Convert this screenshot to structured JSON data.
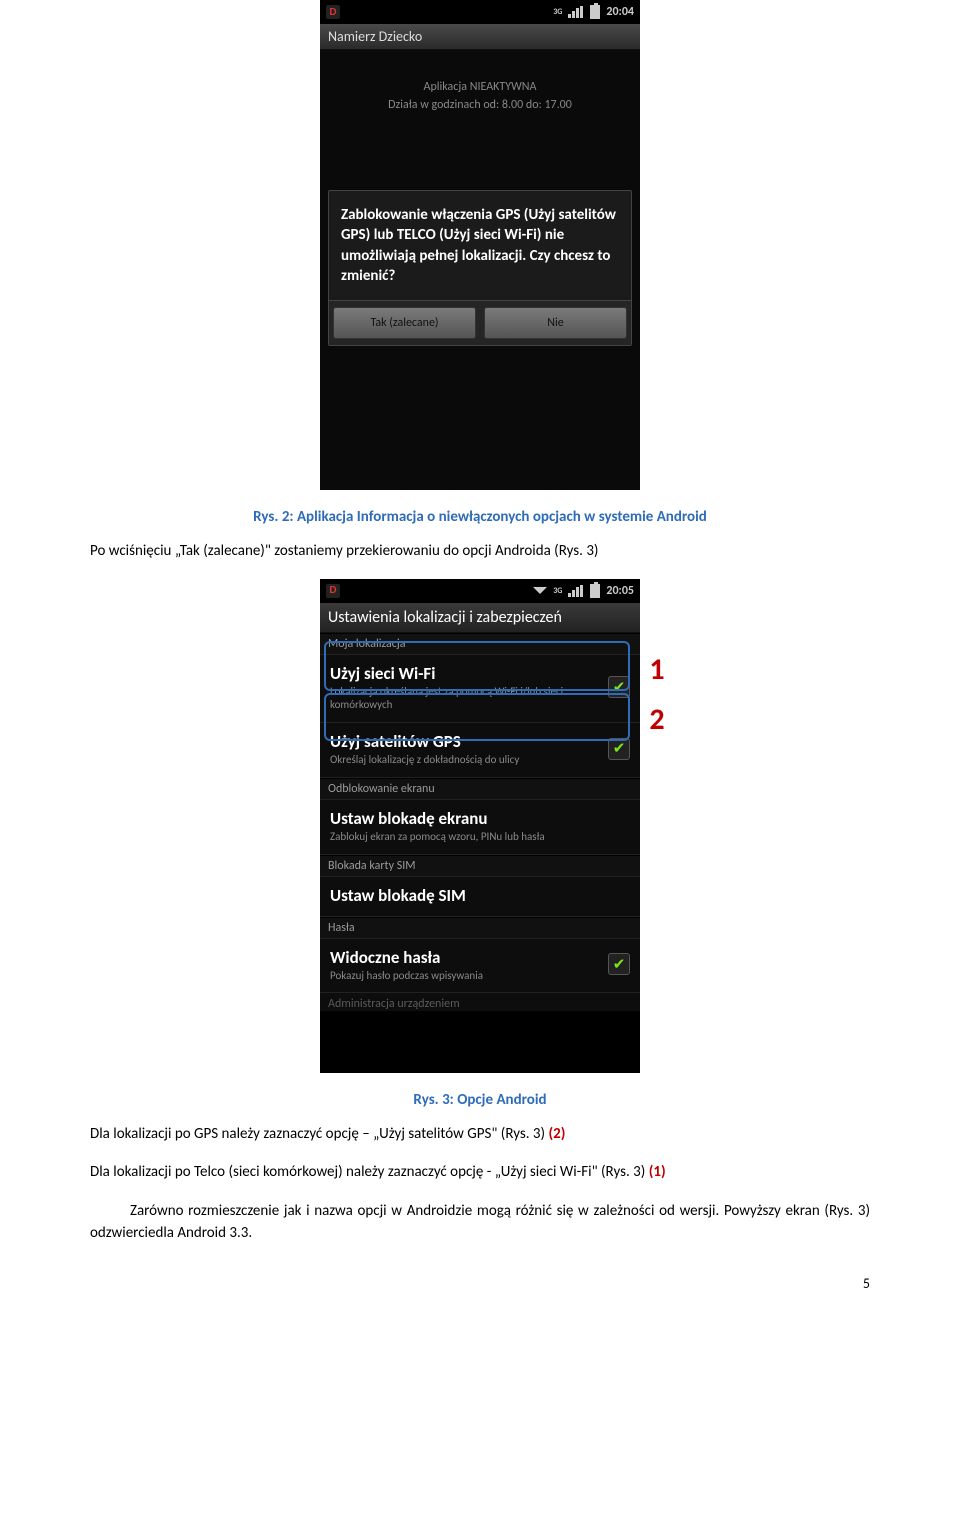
{
  "phone1": {
    "status": {
      "time": "20:04",
      "net": "3G"
    },
    "appTitle": "Namierz Dziecko",
    "inactiveLine1": "Aplikacja NIEAKTYWNA",
    "inactiveLine2": "Działa w godzinach od: 8.00 do: 17.00",
    "dialogText": "Zablokowanie włączenia GPS (Użyj satelitów GPS) lub TELCO (Użyj sieci Wi-Fi) nie umożliwiają pełnej lokalizacji. Czy chcesz to zmienić?",
    "btnYes": "Tak (zalecane)",
    "btnNo": "Nie"
  },
  "caption1": "Rys. 2: Aplikacja Informacja o niewłączonych opcjach w systemie Android",
  "para1": "Po wciśnięciu „Tak (zalecane)\" zostaniemy przekierowaniu do opcji Androida (Rys. 3)",
  "phone2": {
    "status": {
      "time": "20:05",
      "net": "3G"
    },
    "title": "Ustawienia lokalizacji i zabezpieczeń",
    "sections": {
      "loc": "Moja lokalizacja",
      "unlock": "Odblokowanie ekranu",
      "sim": "Blokada karty SIM",
      "pwd": "Hasła",
      "admin": "Administracja urządzeniem"
    },
    "rows": {
      "wifi": {
        "title": "Użyj sieci Wi-Fi",
        "sub": "Lokalizacja określana jest za pomocą Wi-Fi i/lub sieci komórkowych"
      },
      "gps": {
        "title": "Użyj satelitów GPS",
        "sub": "Określaj lokalizację z dokładnością do ulicy"
      },
      "screenLock": {
        "title": "Ustaw blokadę ekranu",
        "sub": "Zablokuj ekran za pomocą wzoru, PINu lub hasła"
      },
      "simLock": {
        "title": "Ustaw blokadę SIM",
        "sub": ""
      },
      "visiblePwd": {
        "title": "Widoczne hasła",
        "sub": "Pokazuj hasło podczas wpisywania"
      }
    }
  },
  "annotations": {
    "one": "1",
    "two": "2"
  },
  "caption2": "Rys. 3: Opcje Android",
  "para2a": "Dla lokalizacji po GPS należy zaznaczyć opcję – „Użyj satelitów GPS\" (Rys. 3) ",
  "para2a_red": "(2)",
  "para2b": "Dla lokalizacji po Telco (sieci komórkowej) należy zaznaczyć opcję - „Użyj sieci Wi-Fi\" (Rys. 3) ",
  "para2b_red": "(1)",
  "para3": "Zarówno rozmieszczenie jak i nazwa opcji w Androidzie mogą różnić się w zależności od wersji. Powyższy ekran (Rys. 3) odzwierciedla Android 3.3.",
  "pageNum": "5"
}
